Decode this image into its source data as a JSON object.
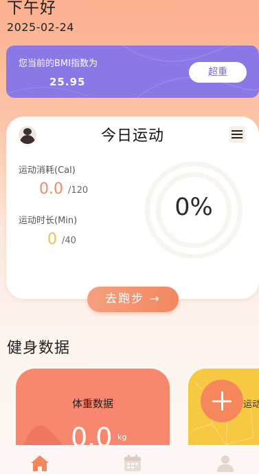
{
  "header": {
    "greeting": "下午好",
    "date": "2025-02-24"
  },
  "bmi": {
    "title": "您当前的BMI指数为",
    "value": "25.95",
    "status_button": "超重"
  },
  "sport": {
    "title": "今日运动",
    "calories": {
      "label": "运动消耗(Cal)",
      "value": "0.0",
      "target": "/120"
    },
    "duration": {
      "label": "运动时长(Min)",
      "value": "0",
      "target": "/40"
    },
    "progress_text": "0%",
    "progress": 0
  },
  "run_button": "去跑步 →",
  "fitness": {
    "section_title": "健身数据",
    "weight": {
      "title": "体重数据",
      "value": "0.0",
      "unit": "kg"
    },
    "exercise_label": "运动"
  },
  "tabs": [
    {
      "icon": "home-icon",
      "active": true
    },
    {
      "icon": "calendar-icon",
      "active": false
    },
    {
      "icon": "user-icon",
      "active": false
    }
  ],
  "colors": {
    "accent_orange": "#f2875f",
    "bmi_purple": "#8b77e6",
    "calorie_value": "#ef8a64",
    "duration_value": "#f4bc53",
    "weight_card": "#f7876f",
    "exercise_card": "#f7c842"
  }
}
